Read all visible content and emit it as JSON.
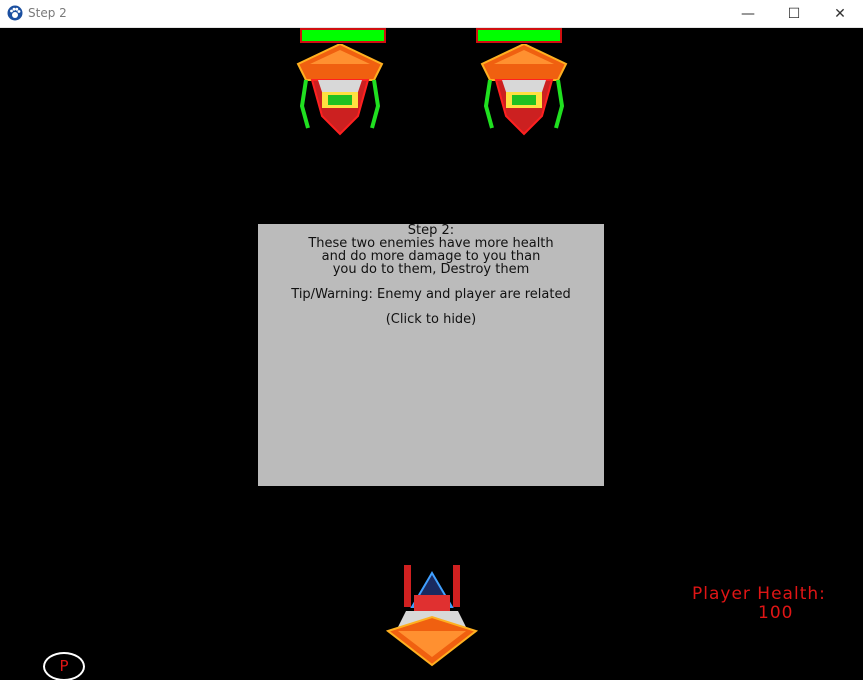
{
  "window": {
    "title": "Step 2",
    "minimize": "—",
    "maximize": "☐",
    "close": "✕"
  },
  "enemies": [
    {
      "health_fraction": 1.0
    },
    {
      "health_fraction": 1.0
    }
  ],
  "dialog": {
    "heading": "Step 2:",
    "line1": "These two enemies have more health",
    "line2": "and do more damage to you than",
    "line3": "you do to them, Destroy them",
    "tip": "Tip/Warning: Enemy and player are related",
    "hide": "(Click to hide)"
  },
  "player": {
    "health_label": "Player Health:",
    "health_value": "100"
  },
  "pause_button": {
    "label": "P"
  },
  "colors": {
    "health_fill": "#00ff00",
    "health_border": "#d01010",
    "hud_text": "#e01515",
    "dialog_bg": "#bbbbbb"
  }
}
